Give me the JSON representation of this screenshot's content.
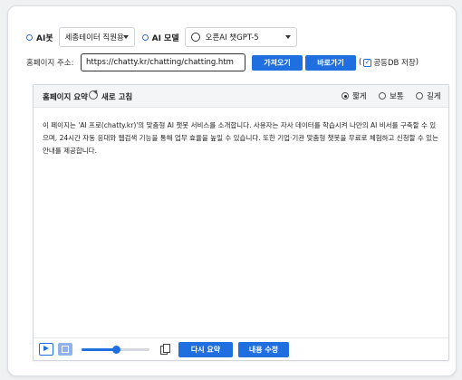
{
  "ai_bot": {
    "label": "AI봇",
    "selected": "세종테이터 직원용"
  },
  "ai_model": {
    "label": "AI 모델",
    "icon": "openai-logo-icon",
    "selected": "오픈AI 챗GPT-5"
  },
  "homepage": {
    "label": "홈페이지 주소:",
    "url": "https://chatty.kr/chatting/chatting.htm",
    "fetch_label": "가져오기",
    "go_label": "바로가기",
    "shared_db_label": "공동DB 저장",
    "shared_db_checked": true,
    "paren_open": "(",
    "paren_close": ")"
  },
  "summary_panel": {
    "title": "홈페이지 요약",
    "refresh_label": "새로 고침",
    "refresh_icon": "refresh-icon",
    "length_options": [
      {
        "label": "짧게",
        "selected": true
      },
      {
        "label": "보통",
        "selected": false
      },
      {
        "label": "길게",
        "selected": false
      }
    ],
    "text": "이 페이지는 'AI 프로(chatty.kr)'의 맞춤형 AI 챗봇 서비스를 소개합니다. 사용자는 자사 데이터를 학습시켜 나만의 AI 비서를 구축할 수 있으며, 24시간 자동 응대와 웹검색 기능을 통해 업무 효율을 높일 수 있습니다. 또한 기업·기관 맞춤형 챗봇을 무료로 체험하고 신청할 수 있는 안내를 제공합니다."
  },
  "playback": {
    "play_icon": "play-icon",
    "stop_icon": "stop-icon",
    "progress": 0.5,
    "copy_icon": "copy-icon"
  },
  "actions": {
    "resummarize_label": "다시 요약",
    "edit_label": "내용 수정"
  },
  "colors": {
    "accent": "#1f6fe0"
  }
}
